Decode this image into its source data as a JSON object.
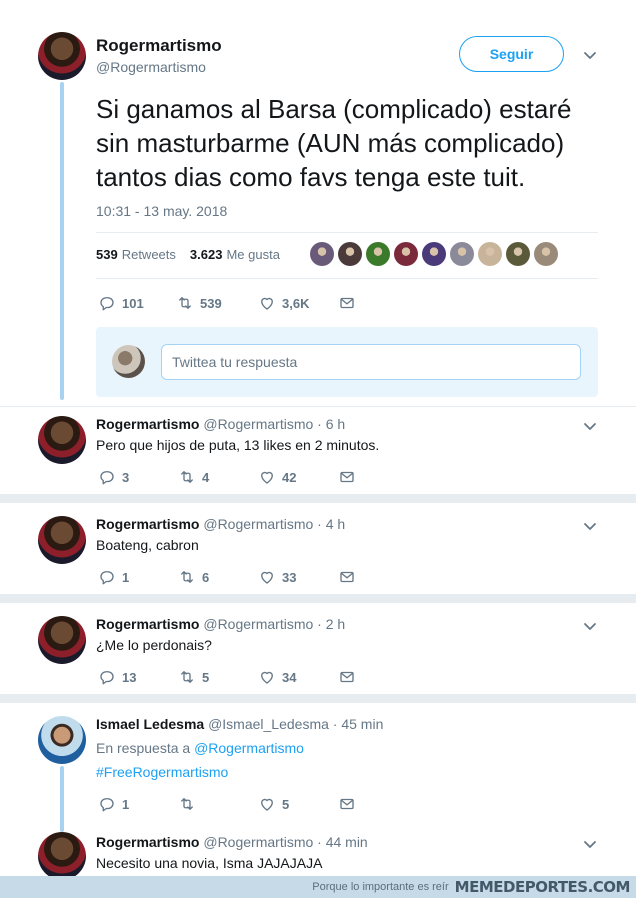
{
  "main_tweet": {
    "name": "Rogermartismo",
    "handle": "@Rogermartismo",
    "follow_label": "Seguir",
    "text": "Si ganamos al Barsa (complicado) estaré sin masturbarme (AUN más complicado) tantos dias como favs tenga este tuit.",
    "date": "10:31 - 13 may. 2018",
    "retweets_count": "539",
    "retweets_label": "Retweets",
    "likes_count": "3.623",
    "likes_label": "Me gusta",
    "liker_faces": [
      "#6a5a7a",
      "#4a3a3a",
      "#3a7a2a",
      "#7a2a3a",
      "#4a3a7a",
      "#8a8a9a",
      "#c8b49a",
      "#5a5a3a",
      "#9a8a7a"
    ],
    "actions": {
      "replies": "101",
      "retweets": "539",
      "likes": "3,6K"
    },
    "reply_placeholder": "Twittea tu respuesta"
  },
  "replies": [
    {
      "name": "Rogermartismo",
      "handle": "@Rogermartismo · 6 h",
      "text": "Pero que hijos de puta, 13 likes en 2 minutos.",
      "replies": "3",
      "retweets": "4",
      "likes": "42"
    },
    {
      "name": "Rogermartismo",
      "handle": "@Rogermartismo · 4 h",
      "text": "Boateng, cabron",
      "replies": "1",
      "retweets": "6",
      "likes": "33"
    },
    {
      "name": "Rogermartismo",
      "handle": "@Rogermartismo · 2 h",
      "text": "¿Me lo perdonais?",
      "replies": "13",
      "retweets": "5",
      "likes": "34"
    },
    {
      "name": "Ismael Ledesma",
      "handle": "@Ismael_Ledesma · 45 min",
      "in_reply_prefix": "En respuesta a",
      "in_reply_to": "@Rogermartismo",
      "text": "#FreeRogermartismo",
      "replies": "1",
      "retweets": "",
      "likes": "5"
    },
    {
      "name": "Rogermartismo",
      "handle": "@Rogermartismo · 44 min",
      "text": "Necesito una novia, Isma JAJAJAJA"
    }
  ],
  "footer": {
    "slogan": "Porque lo importante es reír",
    "brand": "MEMEDEPORTES.COM"
  }
}
